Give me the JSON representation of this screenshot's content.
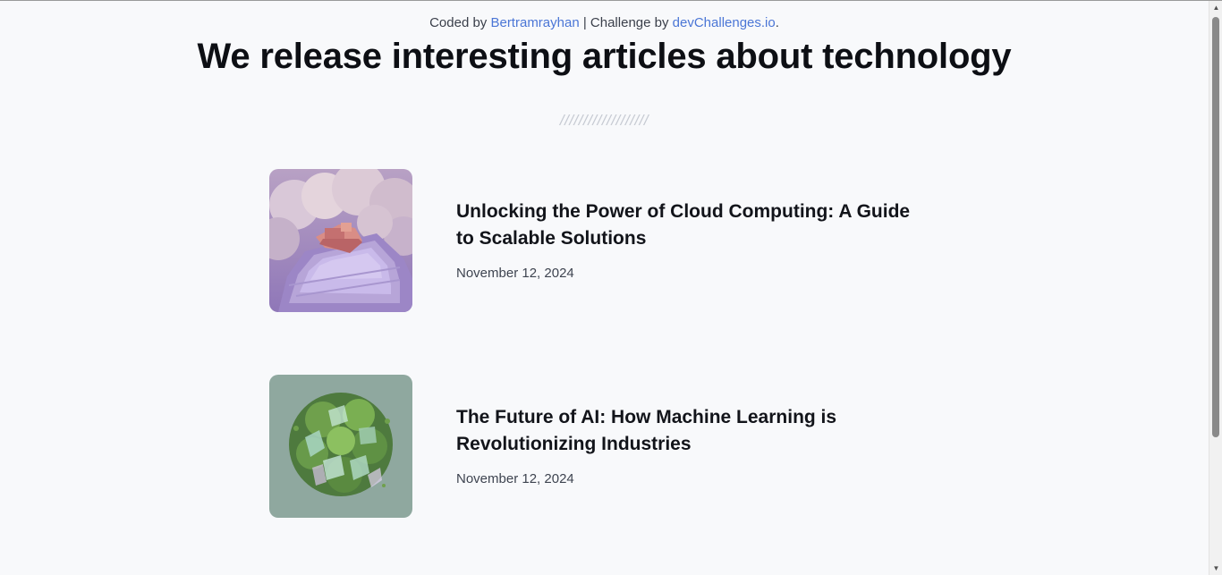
{
  "credit": {
    "prefix": "Coded by ",
    "author": "Bertramrayhan",
    "middle": " | Challenge by ",
    "challenge": "devChallenges.io",
    "suffix": "."
  },
  "headline": "We release interesting articles about technology",
  "divider": "///////////////////",
  "articles": [
    {
      "title": "Unlocking the Power of Cloud Computing: A Guide to Scalable Solutions",
      "date": "November 12, 2024",
      "image_icon": "cloud-platform-image"
    },
    {
      "title": "The Future of AI: How Machine Learning is Revolutionizing Industries",
      "date": "November 12, 2024",
      "image_icon": "green-crystal-sphere-image"
    }
  ],
  "colors": {
    "link": "#4b76d6",
    "background": "#f8f9fb",
    "title": "#12141a",
    "date": "#3e4450"
  },
  "scrollbar": {
    "up_glyph": "▲",
    "down_glyph": "▼"
  }
}
